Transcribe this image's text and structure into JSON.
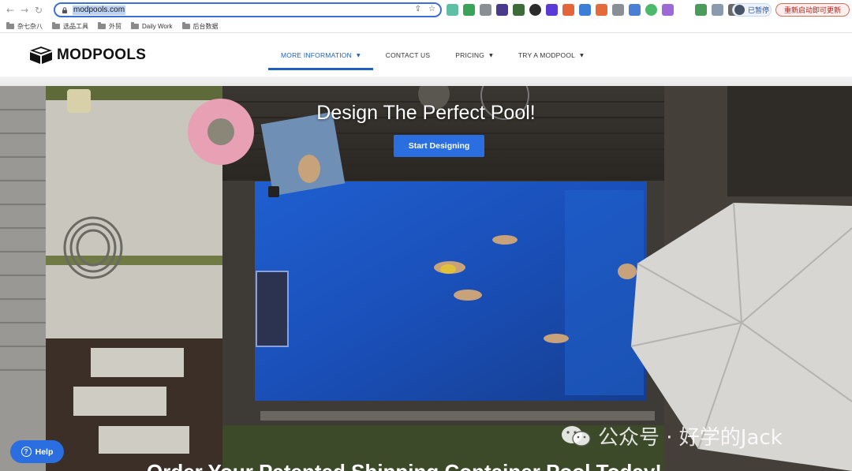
{
  "browser": {
    "url": "modpools.com",
    "profile_label": "已暂停",
    "update_label": "重新启动即可更新",
    "bookmarks": [
      "杂七杂八",
      "选品工具",
      "外贸",
      "Daily Work",
      "后台数据"
    ]
  },
  "site": {
    "logo_text": "MODPOOLS",
    "nav": [
      {
        "label": "MORE INFORMATION",
        "has_dropdown": true,
        "active": true
      },
      {
        "label": "CONTACT US",
        "has_dropdown": false,
        "active": false
      },
      {
        "label": "PRICING",
        "has_dropdown": true,
        "active": false
      },
      {
        "label": "TRY A MODPOOL",
        "has_dropdown": true,
        "active": false
      }
    ],
    "accent_color": "#2a6ee0"
  },
  "hero": {
    "title": "Design The Perfect Pool!",
    "cta_label": "Start Designing",
    "subtitle": "Order Your Patented Shipping Container Pool Today!"
  },
  "help_label": "Help",
  "watermark_text": "公众号 · 好学的Jack"
}
